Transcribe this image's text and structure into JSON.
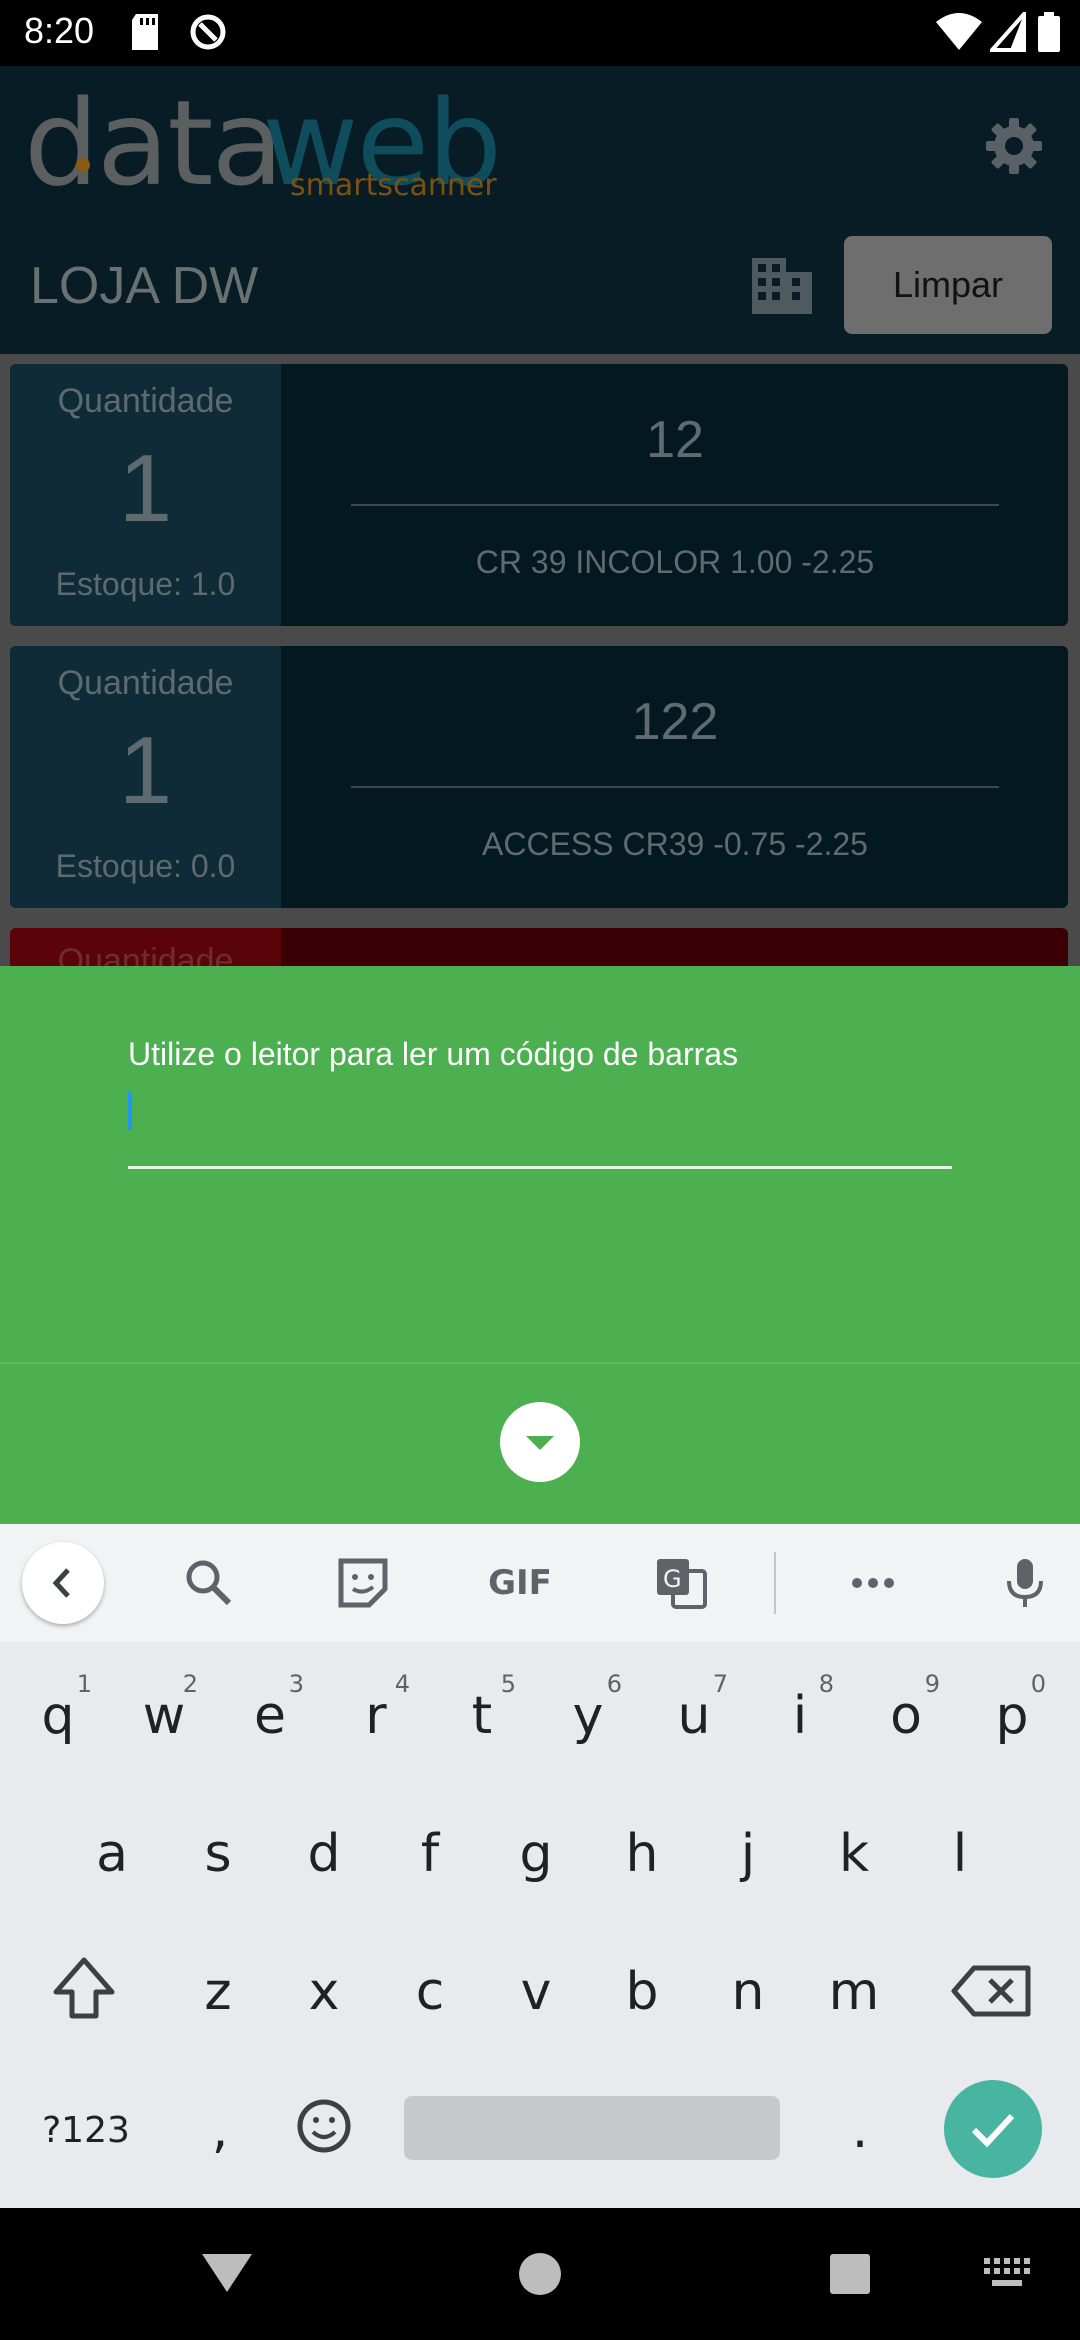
{
  "status_bar": {
    "time": "8:20"
  },
  "app_header": {
    "logo_data": "data",
    "logo_web": "web",
    "logo_sub": "smartscanner",
    "store_title": "LOJA DW",
    "clear_button": "Limpar"
  },
  "items": [
    {
      "quantity_label": "Quantidade",
      "quantity": "1",
      "stock": "Estoque: 1.0",
      "code": "12",
      "description": "CR 39 INCOLOR  1.00 -2.25"
    },
    {
      "quantity_label": "Quantidade",
      "quantity": "1",
      "stock": "Estoque: 0.0",
      "code": "122",
      "description": "ACCESS CR39 -0.75 -2.25"
    },
    {
      "quantity_label": "Quantidade"
    }
  ],
  "scan_sheet": {
    "label": "Utilize o leitor para ler um código de barras",
    "input_value": ""
  },
  "keyboard": {
    "row1": [
      "q",
      "w",
      "e",
      "r",
      "t",
      "y",
      "u",
      "i",
      "o",
      "p"
    ],
    "row1_hints": [
      "1",
      "2",
      "3",
      "4",
      "5",
      "6",
      "7",
      "8",
      "9",
      "0"
    ],
    "row2": [
      "a",
      "s",
      "d",
      "f",
      "g",
      "h",
      "j",
      "k",
      "l"
    ],
    "row3": [
      "z",
      "x",
      "c",
      "v",
      "b",
      "n",
      "m"
    ],
    "symbols_key": "?123",
    "comma": ",",
    "period": ".",
    "gif": "GIF"
  },
  "colors": {
    "sheet_green": "#4caf50",
    "enter_teal": "#48b5a3",
    "header_bg": "#071c24"
  }
}
